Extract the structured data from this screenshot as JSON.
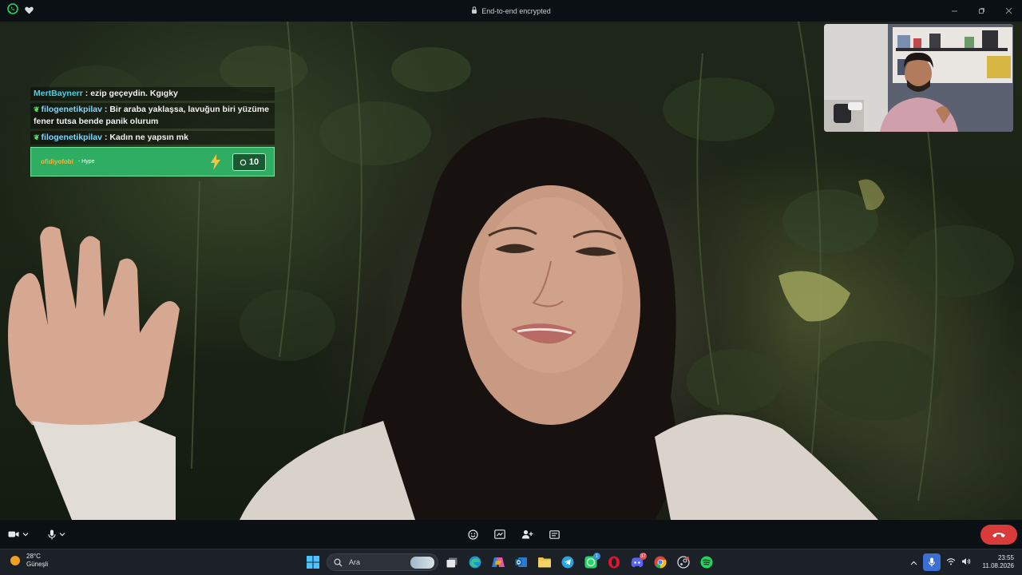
{
  "window": {
    "encryption_text": "End-to-end encrypted"
  },
  "chat": {
    "messages": [
      {
        "user": "MertBaynerr",
        "text": ": ezip geçeydin. Kgıgky",
        "has_badge": false
      },
      {
        "user": "filogenetikpilav",
        "text": ": Bir araba yaklaşsa, lavuğun biri yüzüme fener tutsa bende panik olurum",
        "has_badge": true
      },
      {
        "user": "filogenetikpilav",
        "text": ": Kadın ne yapsın mk",
        "has_badge": true
      }
    ],
    "hype": {
      "user": "ofidiyofobi",
      "label": "- Hype",
      "count": "10"
    }
  },
  "weather": {
    "temperature": "28°C",
    "condition": "Güneşli"
  },
  "search": {
    "placeholder": "Ara"
  },
  "taskbar": {
    "apps": [
      "windows-start",
      "search",
      "task-view",
      "edge",
      "copilot",
      "outlook",
      "file-explorer",
      "telegram",
      "whatsapp",
      "opera",
      "discord",
      "chrome",
      "steam",
      "spotify"
    ],
    "badges": {
      "whatsapp": "1",
      "discord": "37"
    }
  },
  "clock": {
    "time": "23:55",
    "date": "11.08.2026"
  },
  "colors": {
    "end_call": "#d93a3a",
    "hype_green": "#2fae63",
    "whatsapp_green": "#25d366",
    "chat_user": "#3fd4f0"
  }
}
